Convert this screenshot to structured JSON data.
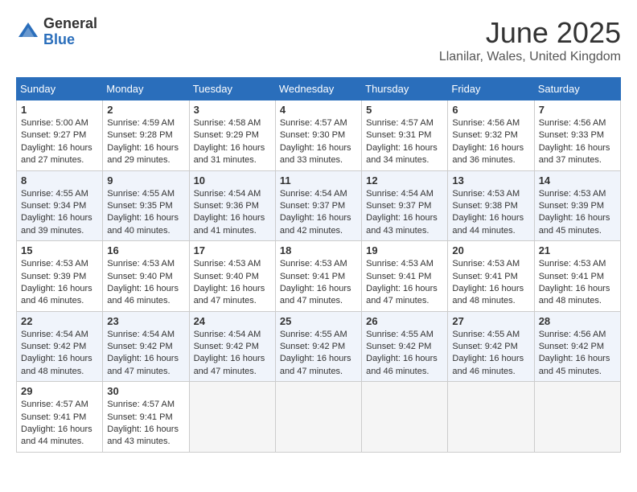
{
  "logo": {
    "general": "General",
    "blue": "Blue"
  },
  "title": "June 2025",
  "subtitle": "Llanilar, Wales, United Kingdom",
  "headers": [
    "Sunday",
    "Monday",
    "Tuesday",
    "Wednesday",
    "Thursday",
    "Friday",
    "Saturday"
  ],
  "weeks": [
    [
      {
        "day": "1",
        "info": "Sunrise: 5:00 AM\nSunset: 9:27 PM\nDaylight: 16 hours and 27 minutes."
      },
      {
        "day": "2",
        "info": "Sunrise: 4:59 AM\nSunset: 9:28 PM\nDaylight: 16 hours and 29 minutes."
      },
      {
        "day": "3",
        "info": "Sunrise: 4:58 AM\nSunset: 9:29 PM\nDaylight: 16 hours and 31 minutes."
      },
      {
        "day": "4",
        "info": "Sunrise: 4:57 AM\nSunset: 9:30 PM\nDaylight: 16 hours and 33 minutes."
      },
      {
        "day": "5",
        "info": "Sunrise: 4:57 AM\nSunset: 9:31 PM\nDaylight: 16 hours and 34 minutes."
      },
      {
        "day": "6",
        "info": "Sunrise: 4:56 AM\nSunset: 9:32 PM\nDaylight: 16 hours and 36 minutes."
      },
      {
        "day": "7",
        "info": "Sunrise: 4:56 AM\nSunset: 9:33 PM\nDaylight: 16 hours and 37 minutes."
      }
    ],
    [
      {
        "day": "8",
        "info": "Sunrise: 4:55 AM\nSunset: 9:34 PM\nDaylight: 16 hours and 39 minutes."
      },
      {
        "day": "9",
        "info": "Sunrise: 4:55 AM\nSunset: 9:35 PM\nDaylight: 16 hours and 40 minutes."
      },
      {
        "day": "10",
        "info": "Sunrise: 4:54 AM\nSunset: 9:36 PM\nDaylight: 16 hours and 41 minutes."
      },
      {
        "day": "11",
        "info": "Sunrise: 4:54 AM\nSunset: 9:37 PM\nDaylight: 16 hours and 42 minutes."
      },
      {
        "day": "12",
        "info": "Sunrise: 4:54 AM\nSunset: 9:37 PM\nDaylight: 16 hours and 43 minutes."
      },
      {
        "day": "13",
        "info": "Sunrise: 4:53 AM\nSunset: 9:38 PM\nDaylight: 16 hours and 44 minutes."
      },
      {
        "day": "14",
        "info": "Sunrise: 4:53 AM\nSunset: 9:39 PM\nDaylight: 16 hours and 45 minutes."
      }
    ],
    [
      {
        "day": "15",
        "info": "Sunrise: 4:53 AM\nSunset: 9:39 PM\nDaylight: 16 hours and 46 minutes."
      },
      {
        "day": "16",
        "info": "Sunrise: 4:53 AM\nSunset: 9:40 PM\nDaylight: 16 hours and 46 minutes."
      },
      {
        "day": "17",
        "info": "Sunrise: 4:53 AM\nSunset: 9:40 PM\nDaylight: 16 hours and 47 minutes."
      },
      {
        "day": "18",
        "info": "Sunrise: 4:53 AM\nSunset: 9:41 PM\nDaylight: 16 hours and 47 minutes."
      },
      {
        "day": "19",
        "info": "Sunrise: 4:53 AM\nSunset: 9:41 PM\nDaylight: 16 hours and 47 minutes."
      },
      {
        "day": "20",
        "info": "Sunrise: 4:53 AM\nSunset: 9:41 PM\nDaylight: 16 hours and 48 minutes."
      },
      {
        "day": "21",
        "info": "Sunrise: 4:53 AM\nSunset: 9:41 PM\nDaylight: 16 hours and 48 minutes."
      }
    ],
    [
      {
        "day": "22",
        "info": "Sunrise: 4:54 AM\nSunset: 9:42 PM\nDaylight: 16 hours and 48 minutes."
      },
      {
        "day": "23",
        "info": "Sunrise: 4:54 AM\nSunset: 9:42 PM\nDaylight: 16 hours and 47 minutes."
      },
      {
        "day": "24",
        "info": "Sunrise: 4:54 AM\nSunset: 9:42 PM\nDaylight: 16 hours and 47 minutes."
      },
      {
        "day": "25",
        "info": "Sunrise: 4:55 AM\nSunset: 9:42 PM\nDaylight: 16 hours and 47 minutes."
      },
      {
        "day": "26",
        "info": "Sunrise: 4:55 AM\nSunset: 9:42 PM\nDaylight: 16 hours and 46 minutes."
      },
      {
        "day": "27",
        "info": "Sunrise: 4:55 AM\nSunset: 9:42 PM\nDaylight: 16 hours and 46 minutes."
      },
      {
        "day": "28",
        "info": "Sunrise: 4:56 AM\nSunset: 9:42 PM\nDaylight: 16 hours and 45 minutes."
      }
    ],
    [
      {
        "day": "29",
        "info": "Sunrise: 4:57 AM\nSunset: 9:41 PM\nDaylight: 16 hours and 44 minutes."
      },
      {
        "day": "30",
        "info": "Sunrise: 4:57 AM\nSunset: 9:41 PM\nDaylight: 16 hours and 43 minutes."
      },
      {
        "day": "",
        "info": ""
      },
      {
        "day": "",
        "info": ""
      },
      {
        "day": "",
        "info": ""
      },
      {
        "day": "",
        "info": ""
      },
      {
        "day": "",
        "info": ""
      }
    ]
  ]
}
